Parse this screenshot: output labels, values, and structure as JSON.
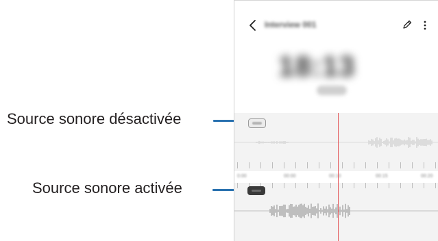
{
  "callouts": {
    "source_off": "Source sonore désactivée",
    "source_on": "Source sonore activée"
  },
  "phone": {
    "header": {
      "back_icon": "chevron-left-icon",
      "title": "Interview 001",
      "edit_icon": "pencil-icon",
      "more_icon": "more-vertical-icon"
    },
    "timer": "18:13",
    "ruler_labels": [
      "0:00",
      "00:00",
      "00:10",
      "00:15",
      "00:20"
    ],
    "speakers": [
      {
        "state": "off",
        "color": "#ececec"
      },
      {
        "state": "on",
        "color": "#3a3a3a"
      }
    ]
  },
  "colors": {
    "callout_line": "#2a72b0",
    "playhead": "#e4575a",
    "text": "#231f20"
  }
}
